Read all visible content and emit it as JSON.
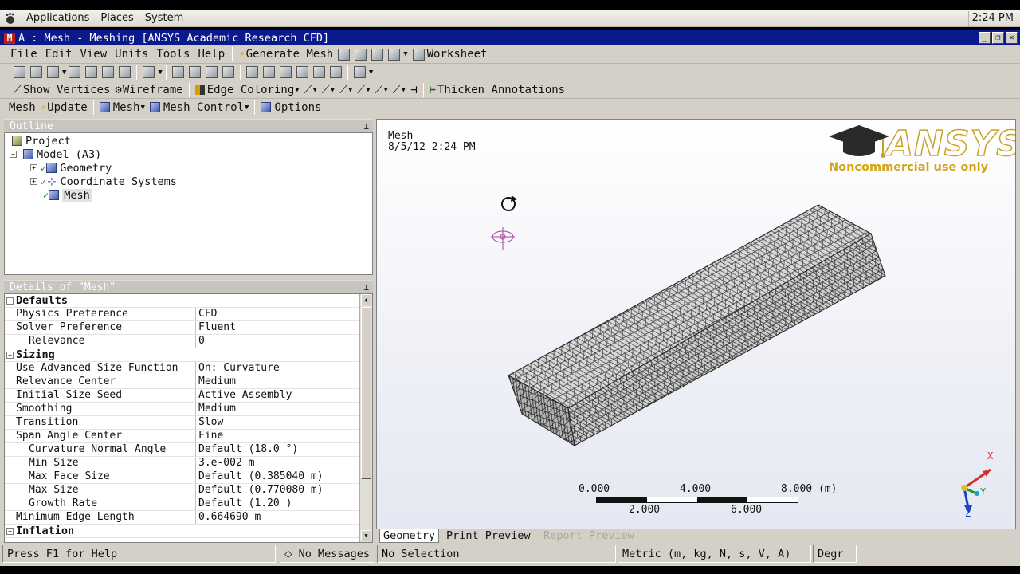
{
  "top_panel": {
    "menus": [
      "Applications",
      "Places",
      "System"
    ],
    "clock": "2:24 PM"
  },
  "window": {
    "title": "A : Mesh - Meshing [ANSYS Academic Research CFD]",
    "controls": [
      "_",
      "❐",
      "✕"
    ]
  },
  "menubar": {
    "items": [
      "File",
      "Edit",
      "View",
      "Units",
      "Tools",
      "Help"
    ],
    "generate_mesh": "Generate Mesh",
    "worksheet": "Worksheet"
  },
  "toolbar2": {
    "show_vertices": "Show Vertices",
    "wireframe": "Wireframe",
    "edge_coloring": "Edge Coloring",
    "thicken_annotations": "Thicken Annotations"
  },
  "context_toolbar": {
    "mesh_label": "Mesh",
    "update": "Update",
    "mesh_menu": "Mesh",
    "mesh_control": "Mesh Control",
    "options": "Options"
  },
  "outline": {
    "header": "Outline",
    "project": "Project",
    "model": "Model (A3)",
    "geometry": "Geometry",
    "coordinate_systems": "Coordinate Systems",
    "mesh": "Mesh"
  },
  "details": {
    "header": "Details of \"Mesh\"",
    "rows": [
      {
        "type": "section",
        "label": "Defaults",
        "box": "−"
      },
      {
        "label": "Physics Preference",
        "value": "CFD"
      },
      {
        "label": "Solver Preference",
        "value": "Fluent"
      },
      {
        "label": "Relevance",
        "value": "0",
        "indent": true
      },
      {
        "type": "section",
        "label": "Sizing",
        "box": "−"
      },
      {
        "label": "Use Advanced Size Function",
        "value": "On: Curvature"
      },
      {
        "label": "Relevance Center",
        "value": "Medium"
      },
      {
        "label": "Initial Size Seed",
        "value": "Active Assembly"
      },
      {
        "label": "Smoothing",
        "value": "Medium"
      },
      {
        "label": "Transition",
        "value": "Slow"
      },
      {
        "label": "Span Angle Center",
        "value": "Fine"
      },
      {
        "label": "Curvature Normal Angle",
        "value": "Default (18.0 °)",
        "indent": true
      },
      {
        "label": "Min Size",
        "value": "3.e-002 m",
        "indent": true
      },
      {
        "label": "Max Face Size",
        "value": "Default (0.385040 m)",
        "indent": true
      },
      {
        "label": "Max Size",
        "value": "Default (0.770080 m)",
        "indent": true
      },
      {
        "label": "Growth Rate",
        "value": "Default (1.20 )",
        "indent": true
      },
      {
        "label": "Minimum Edge Length",
        "value": "0.664690 m"
      },
      {
        "type": "section",
        "label": "Inflation",
        "box": "+"
      }
    ]
  },
  "viewport": {
    "label": "Mesh",
    "date": "8/5/12 2:24 PM",
    "logo_text": "ANSYS",
    "logo_sub": "Noncommercial use only",
    "scale": {
      "top_labels": [
        "0.000",
        "4.000",
        "8.000 (m)"
      ],
      "bottom_labels": [
        "2.000",
        "6.000"
      ]
    },
    "triad": {
      "x": "X",
      "y": "Y",
      "z": "Z"
    }
  },
  "view_tabs": [
    "Geometry",
    "Print Preview",
    "Report Preview"
  ],
  "statusbar": {
    "help": "Press F1 for Help",
    "messages": "No Messages",
    "selection": "No Selection",
    "units": "Metric (m, kg, N, s, V, A)",
    "angle": "Degr"
  },
  "colors": {
    "titlebar": "#0a1a8c",
    "window_bg": "#d4d0c8",
    "logo_gold": "#d4a516"
  }
}
